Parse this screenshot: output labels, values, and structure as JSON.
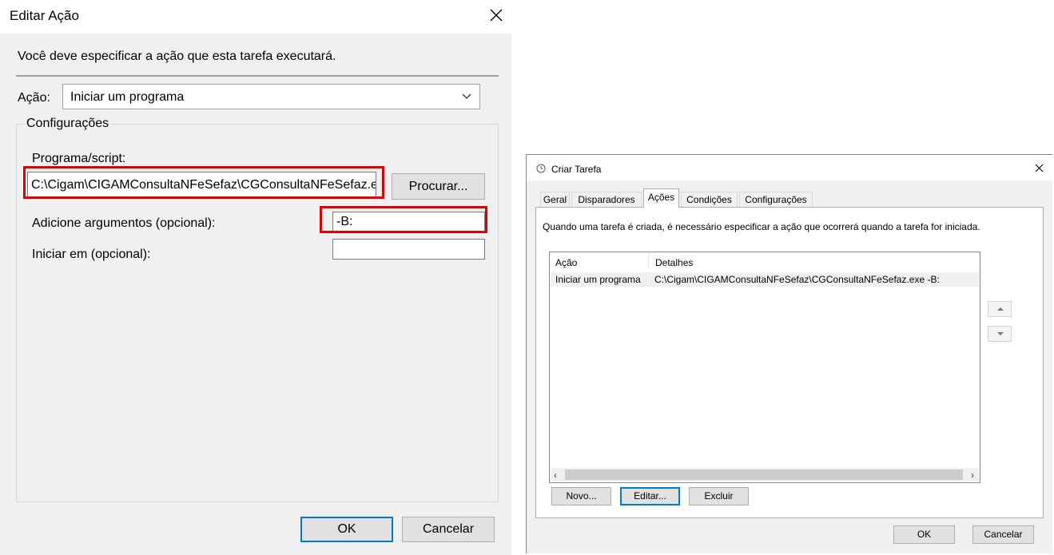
{
  "edit_dialog": {
    "title": "Editar Ação",
    "instruction": "Você deve especificar a ação que esta tarefa executará.",
    "action_label": "Ação:",
    "action_value": "Iniciar um programa",
    "group_label": "Configurações",
    "program_label": "Programa/script:",
    "program_value": "C:\\Cigam\\CIGAMConsultaNFeSefaz\\CGConsultaNFeSefaz.exe",
    "browse_label": "Procurar...",
    "args_label": "Adicione argumentos (opcional):",
    "args_value": "-B:",
    "startin_label": "Iniciar em (opcional):",
    "startin_value": "",
    "ok_label": "OK",
    "cancel_label": "Cancelar",
    "highlight_color": "#e00000"
  },
  "create_dialog": {
    "title": "Criar Tarefa",
    "tabs": [
      {
        "label": "Geral",
        "active": false
      },
      {
        "label": "Disparadores",
        "active": false
      },
      {
        "label": "Ações",
        "active": true
      },
      {
        "label": "Condições",
        "active": false
      },
      {
        "label": "Configurações",
        "active": false
      }
    ],
    "instruction": "Quando uma tarefa é criada, é necessário especificar a ação que ocorrerá quando a tarefa for iniciada.",
    "columns": {
      "action": "Ação",
      "details": "Detalhes"
    },
    "rows": [
      {
        "action": "Iniciar um programa",
        "details": "C:\\Cigam\\CIGAMConsultaNFeSefaz\\CGConsultaNFeSefaz.exe -B:"
      }
    ],
    "buttons": {
      "new": "Novo...",
      "edit": "Editar...",
      "delete": "Excluir"
    },
    "ok_label": "OK",
    "cancel_label": "Cancelar"
  },
  "icons": {
    "close": "close-icon",
    "dropdown": "chevron-down-icon",
    "app": "clock-icon",
    "move_up": "arrow-up-icon",
    "move_down": "arrow-down-icon"
  }
}
